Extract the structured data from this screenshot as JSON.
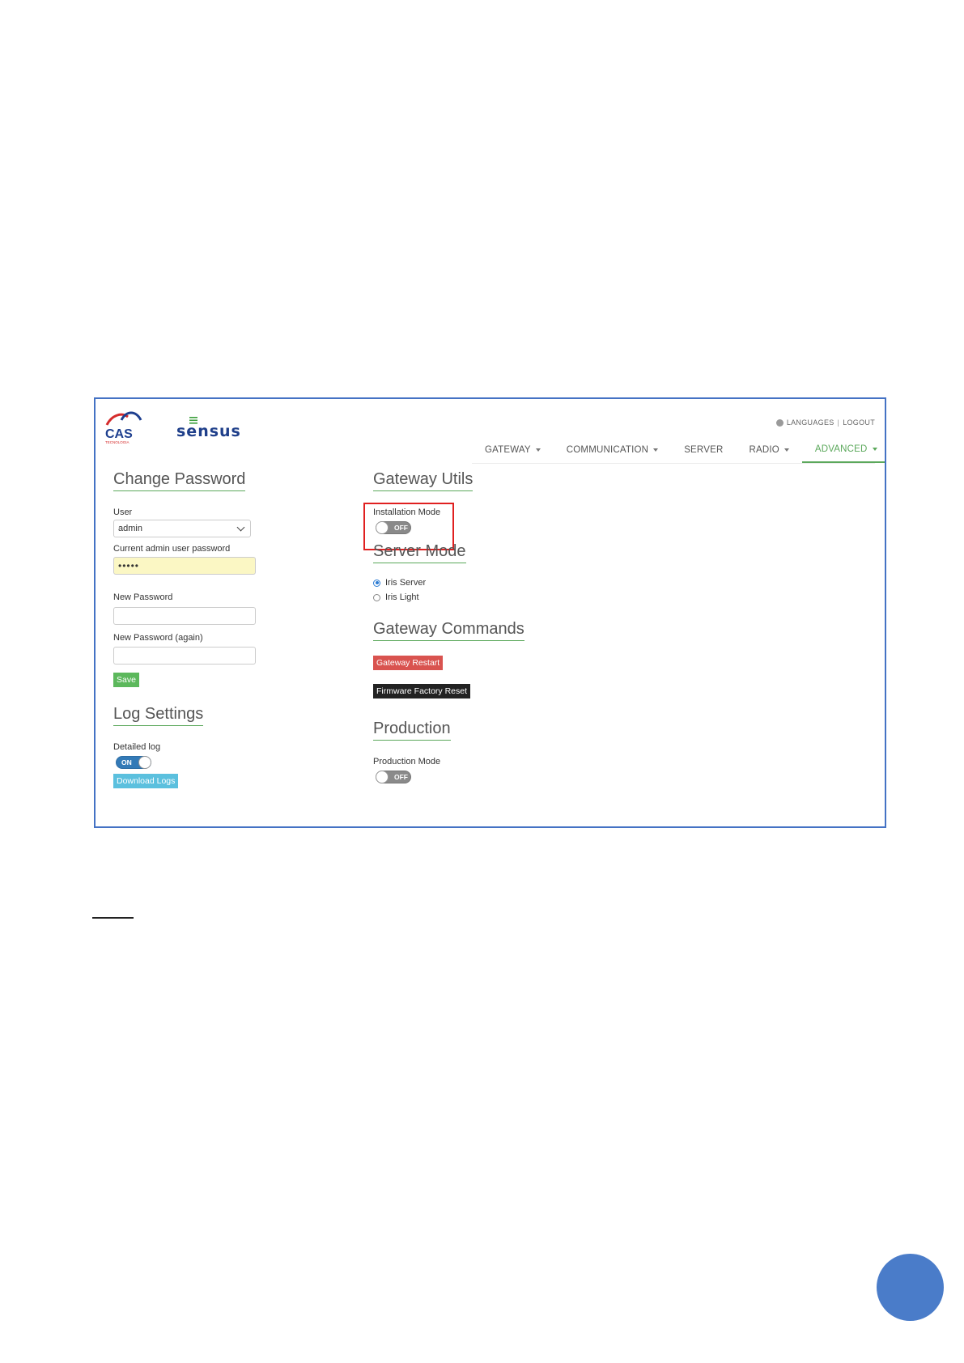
{
  "header": {
    "logo_cas": "CAS",
    "logo_cas_sub": "TECNOLOGIA",
    "logo_sensus": "sensus",
    "languages": "LANGUAGES",
    "separator": "|",
    "logout": "LOGOUT"
  },
  "nav": [
    {
      "label": "GATEWAY",
      "caret": true,
      "active": false
    },
    {
      "label": "COMMUNICATION",
      "caret": true,
      "active": false
    },
    {
      "label": "SERVER",
      "caret": false,
      "active": false
    },
    {
      "label": "RADIO",
      "caret": true,
      "active": false
    },
    {
      "label": "ADVANCED",
      "caret": true,
      "active": true
    }
  ],
  "change_password": {
    "title": "Change Password",
    "user_label": "User",
    "user_value": "admin",
    "current_label": "Current admin user password",
    "current_value": "•••••",
    "new_label": "New Password",
    "new_value": "",
    "again_label": "New Password (again)",
    "again_value": "",
    "save_label": "Save"
  },
  "log_settings": {
    "title": "Log Settings",
    "detailed_label": "Detailed log",
    "detailed_state": "ON",
    "download_label": "Download Logs"
  },
  "gateway_utils": {
    "title": "Gateway Utils",
    "installation_label": "Installation Mode",
    "installation_state": "OFF"
  },
  "server_mode": {
    "title": "Server Mode",
    "options": [
      "Iris Server",
      "Iris Light"
    ],
    "selected": "Iris Server"
  },
  "gateway_commands": {
    "title": "Gateway Commands",
    "restart_label": "Gateway Restart",
    "factory_reset_label": "Firmware Factory Reset"
  },
  "production": {
    "title": "Production",
    "mode_label": "Production Mode",
    "mode_state": "OFF"
  },
  "colors": {
    "accent_green": "#5ba85b",
    "frame_blue": "#4472c4",
    "highlight_red": "#e02020",
    "page_circle": "#4a7cc9"
  }
}
